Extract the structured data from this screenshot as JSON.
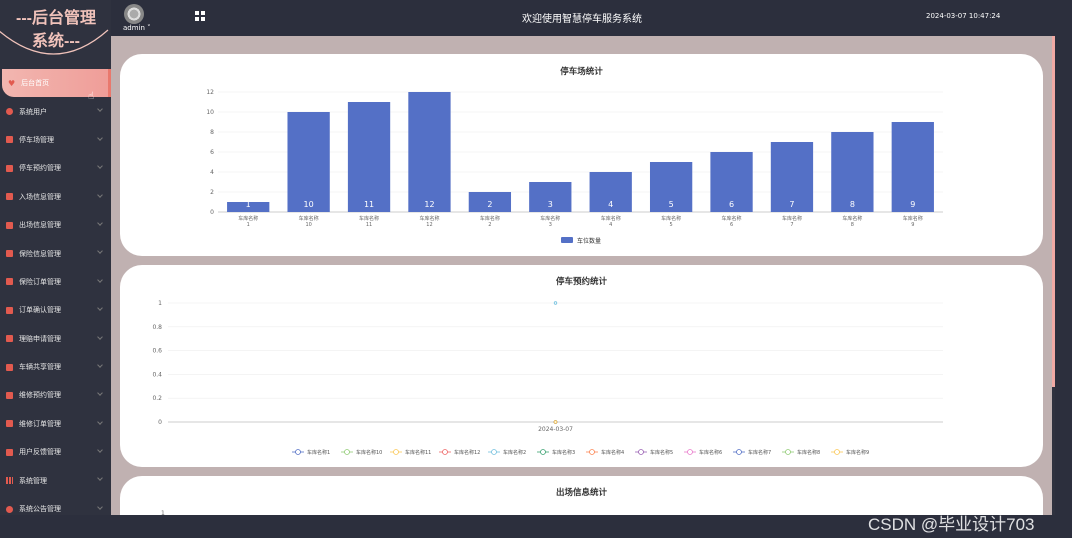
{
  "brand": {
    "line1": "---后台管理",
    "line2": "系统---"
  },
  "header": {
    "user": "admin",
    "title": "欢迎使用智慧停车服务系统",
    "datetime": "2024-03-07 10:47:24"
  },
  "sidebar": {
    "items": [
      {
        "label": "后台首页",
        "icon": "heart-icon",
        "active": true
      },
      {
        "label": "系统用户",
        "icon": "user-icon"
      },
      {
        "label": "停车场管理",
        "icon": "checkbox-icon"
      },
      {
        "label": "停车预约管理",
        "icon": "checkbox-icon"
      },
      {
        "label": "入场信息管理",
        "icon": "checkbox-icon"
      },
      {
        "label": "出场信息管理",
        "icon": "checkbox-icon"
      },
      {
        "label": "保险信息管理",
        "icon": "checkbox-icon"
      },
      {
        "label": "保险订单管理",
        "icon": "checkbox-icon"
      },
      {
        "label": "订单确认管理",
        "icon": "checkbox-icon"
      },
      {
        "label": "理赔申请管理",
        "icon": "checkbox-icon"
      },
      {
        "label": "车辆共享管理",
        "icon": "checkbox-icon"
      },
      {
        "label": "维修预约管理",
        "icon": "checkbox-icon"
      },
      {
        "label": "维修订单管理",
        "icon": "checkbox-icon"
      },
      {
        "label": "用户反馈管理",
        "icon": "checkbox-icon"
      },
      {
        "label": "系统管理",
        "icon": "bar-chart-icon"
      },
      {
        "label": "系统公告管理",
        "icon": "info-icon"
      }
    ]
  },
  "colors": {
    "accent": "#ef9d98",
    "bar": "#5470c6",
    "sidebar": "#2f323f"
  },
  "charts": {
    "parking": {
      "title": "停车场统计"
    },
    "reservation": {
      "title": "停车预约统计"
    },
    "exit": {
      "title": "出场信息统计",
      "first_tick": "1"
    }
  },
  "chart_data": [
    {
      "type": "bar",
      "title": "停车场统计",
      "categories": [
        "车库名称\n1",
        "车库名称\n10",
        "车库名称\n11",
        "车库名称\n12",
        "车库名称\n2",
        "车库名称\n3",
        "车库名称\n4",
        "车库名称\n5",
        "车库名称\n6",
        "车库名称\n7",
        "车库名称\n8",
        "车库名称\n9"
      ],
      "series": [
        {
          "name": "车位数量",
          "values": [
            1,
            10,
            11,
            12,
            2,
            3,
            4,
            5,
            6,
            7,
            8,
            9
          ]
        }
      ],
      "yticks": [
        "0",
        "2",
        "4",
        "6",
        "8",
        "10",
        "12"
      ],
      "ylim": [
        0,
        12
      ],
      "legend": "bottom-center",
      "grid": true
    },
    {
      "type": "line",
      "title": "停车预约统计",
      "x": [
        "2024-03-07"
      ],
      "series": [
        {
          "name": "车库名称1",
          "color": "#5470c6",
          "values": [
            0
          ]
        },
        {
          "name": "车库名称10",
          "color": "#91cc75",
          "values": [
            0
          ]
        },
        {
          "name": "车库名称11",
          "color": "#fac858",
          "values": [
            0
          ]
        },
        {
          "name": "车库名称12",
          "color": "#ee6666",
          "values": [
            0
          ]
        },
        {
          "name": "车库名称2",
          "color": "#73c0de",
          "values": [
            1
          ]
        },
        {
          "name": "车库名称3",
          "color": "#3ba272",
          "values": [
            0
          ]
        },
        {
          "name": "车库名称4",
          "color": "#fc8452",
          "values": [
            0
          ]
        },
        {
          "name": "车库名称5",
          "color": "#9a60b4",
          "values": [
            0
          ]
        },
        {
          "name": "车库名称6",
          "color": "#ea7ccc",
          "values": [
            0
          ]
        },
        {
          "name": "车库名称7",
          "color": "#5470c6",
          "values": [
            0
          ]
        },
        {
          "name": "车库名称8",
          "color": "#91cc75",
          "values": [
            0
          ]
        },
        {
          "name": "车库名称9",
          "color": "#fac858",
          "values": [
            0
          ]
        }
      ],
      "yticks": [
        "0",
        "0.2",
        "0.4",
        "0.6",
        "0.8",
        "1"
      ],
      "ylim": [
        0,
        1
      ],
      "legend": "bottom-center",
      "grid": true
    }
  ],
  "watermark": "CSDN @毕业设计703"
}
